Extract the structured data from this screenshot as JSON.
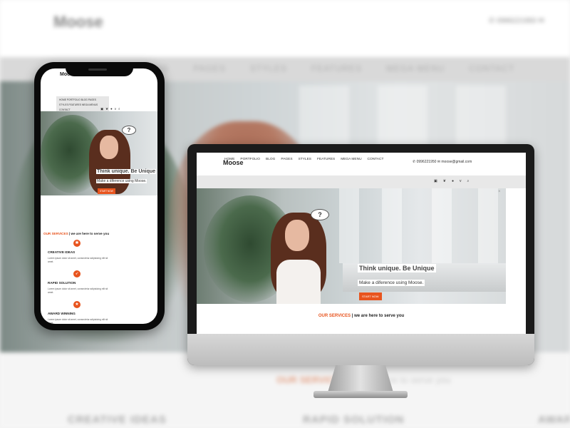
{
  "brand": "Moose",
  "contact": {
    "phone": "0996221950",
    "email": "moose@gmail.com"
  },
  "nav": [
    "HOME",
    "PORTFOLIO",
    "BLOG",
    "PAGES",
    "STYLES",
    "FEATURES",
    "MEGA MENU",
    "CONTACT"
  ],
  "background_nav": [
    "BLOG",
    "PAGES",
    "STYLES",
    "FEATURES",
    "MEGA MENU",
    "CONTACT"
  ],
  "hero": {
    "heading": "Think unique. Be Unique",
    "subheading": "Make a diference using Moose.",
    "button": "START NOW",
    "bubble": "?"
  },
  "services": {
    "accent": "OUR SERVICES",
    "separator": "|",
    "tagline": "we are here to serve you"
  },
  "mobile_menu": {
    "line1": "HOME PORTFOLIO BLOG PAGES",
    "line2": "STYLES FEATURES MEGA MENUS",
    "line3": "CONTACT"
  },
  "service_items": [
    {
      "title": "CREATIVE IDEAS",
      "desc": "Lorem ipsum dolor sit amet, consectetur adipisicing elit sit amet."
    },
    {
      "title": "RAPID SOLUTION",
      "desc": "Lorem ipsum dolor sit amet, consectetur adipisicing elit sit amet."
    },
    {
      "title": "AWARD WINNING",
      "desc": "Lorem ipsum dolor sit amet, consectetur adipisicing elit sit amet."
    }
  ],
  "background_features": [
    "CREATIVE IDEAS",
    "RAPID SOLUTION",
    "AWAR"
  ],
  "icons": {
    "phone": "phone-icon",
    "email": "envelope-icon",
    "social": [
      "linkedin-icon",
      "twitter-icon",
      "flickr-icon",
      "vimeo-icon",
      "search-icon"
    ]
  },
  "colors": {
    "accent": "#e8541e",
    "nav_bg": "#e8e8e8",
    "frame": "#1b1b1b"
  }
}
